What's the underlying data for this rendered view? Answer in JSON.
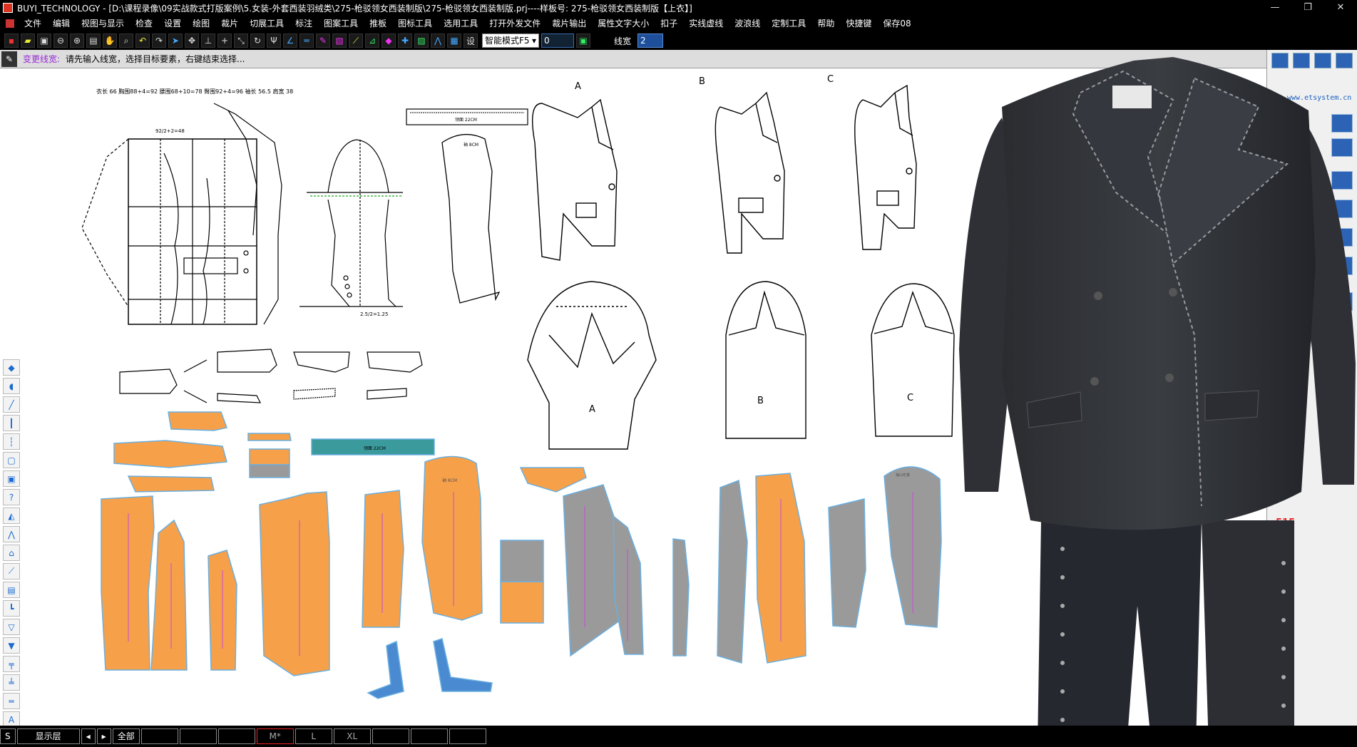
{
  "window": {
    "title": "BUYI_TECHNOLOGY - [D:\\课程录像\\09实战款式打版案例\\5.女装-外套西装羽绒类\\275-枪驳领女西装制版\\275-枪驳领女西装制版.prj----样板号: 275-枪驳领女西装制版【上衣】]",
    "min": "—",
    "max": "❐",
    "close": "✕"
  },
  "menu": [
    "文件",
    "编辑",
    "视图与显示",
    "检查",
    "设置",
    "绘图",
    "裁片",
    "切展工具",
    "标注",
    "图案工具",
    "推板",
    "图标工具",
    "选用工具",
    "打开外发文件",
    "裁片输出",
    "属性文字大小",
    "扣子",
    "实线虚线",
    "波浪线",
    "定制工具",
    "帮助",
    "快捷键",
    "保存08"
  ],
  "toolbar": {
    "set_label": "设",
    "mode_value": "智能模式F5",
    "number_value": "0",
    "linewidth_label": "线宽",
    "linewidth_value": "2"
  },
  "prompt": {
    "command": "变更线宽:",
    "message": "请先输入线宽，选择目标要素，右键结束选择..."
  },
  "drafting": {
    "specs": "衣长 66    胸围88+4=92    腰围68+10=78    臀围92+4=96    袖长 56.5    肩宽 38",
    "label_a": "A",
    "label_b": "B",
    "label_c": "C",
    "collar_label": "领面 22CM",
    "sleeve_top_label": "袖 8CM",
    "measure_1": "92/2+2=48",
    "measure_2": "2.5/2=1.25"
  },
  "pieces": {
    "strip_label": "领面 22CM",
    "sleeve_label": "袖 8CM",
    "cap_label": "袖山吃量"
  },
  "rightpanel": {
    "site": "www.etsystem.cn",
    "red_number": "515"
  },
  "statusbar": {
    "s_label": "S",
    "layer_label": "显示层",
    "all_label": "全部",
    "size_m": "M*",
    "size_l": "L",
    "size_xl": "XL"
  },
  "colors": {
    "piece_orange": "#f6a04a",
    "piece_gray": "#9a9a9a",
    "piece_teal": "#3a9a9c",
    "piece_blue": "#4a8ad0",
    "outline_blue": "#6ab0e0",
    "accent_magenta": "#c94ad6"
  }
}
